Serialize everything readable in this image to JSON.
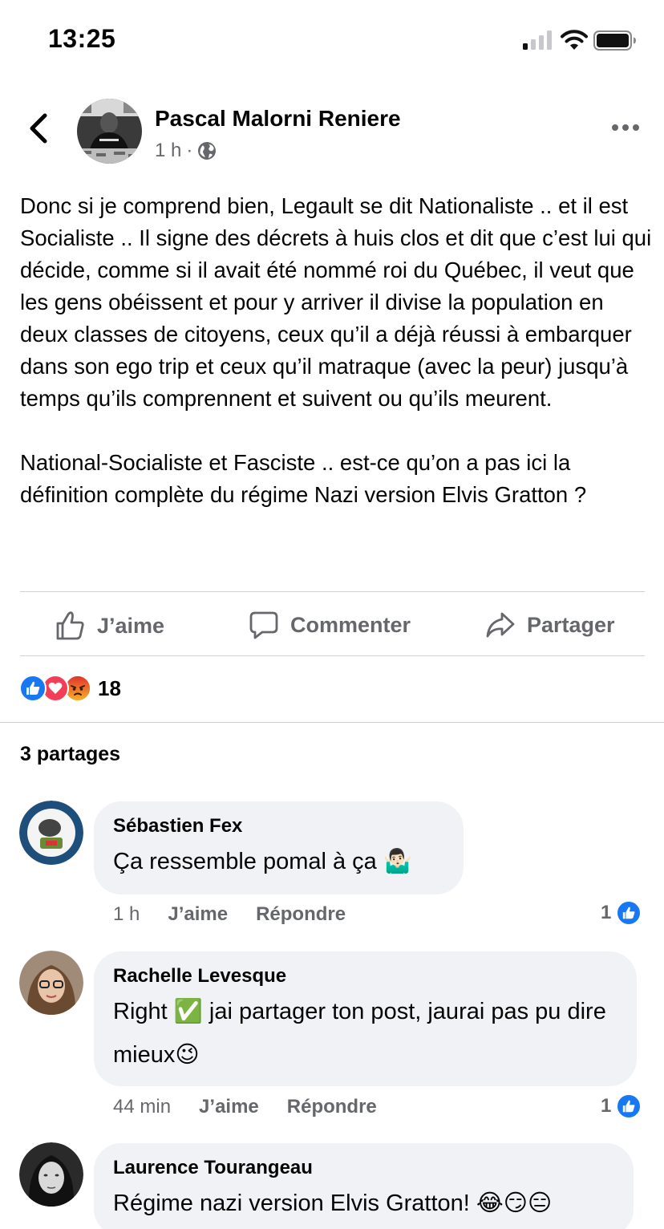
{
  "status_bar": {
    "time": "13:25"
  },
  "header": {
    "author": "Pascal Malorni Reniere",
    "time": "1 h",
    "separator": "·",
    "audience_icon": "globe-icon"
  },
  "post": {
    "text": "Donc si je comprend bien, Legault se dit Nationaliste .. et il est Socialiste .. Il signe des décrets à huis clos et dit que c’est lui qui décide, comme si il avait été nommé roi du Québec, il veut que les gens obéissent et pour y arriver il divise la population en deux classes de citoyens, ceux qu’il a déjà réussi à embarquer dans son ego trip et ceux qu’il matraque (avec la peur) jusqu’à temps qu’ils comprennent et suivent ou qu’ils meurent.\n\nNational-Socialiste et Fasciste .. est-ce qu’on a pas ici la définition complète du régime Nazi version Elvis Gratton ?"
  },
  "actions": {
    "like_label": "J’aime",
    "comment_label": "Commenter",
    "share_label": "Partager"
  },
  "reactions": {
    "icons": [
      "like-reaction-icon",
      "love-reaction-icon",
      "angry-reaction-icon"
    ],
    "count": "18"
  },
  "shares_label": "3 partages",
  "comments": [
    {
      "name": "Sébastien Fex",
      "text": "Ça ressemble pomal à ça 🤷🏻‍♂️",
      "time": "1 h",
      "like_label": "J’aime",
      "reply_label": "Répondre",
      "like_count": "1"
    },
    {
      "name": "Rachelle Levesque",
      "text": "Right ✅ jai partager ton post, jaurai pas pu dire mieux😉",
      "time": "44 min",
      "like_label": "J’aime",
      "reply_label": "Répondre",
      "like_count": "1"
    },
    {
      "name": "Laurence Tourangeau",
      "text": "Régime nazi version Elvis Gratton! 😂😏😑"
    }
  ],
  "colors": {
    "facebook_blue": "#1877f2",
    "secondary_text": "#65676b",
    "bubble_bg": "#f0f2f5",
    "love_red": "#f33e58",
    "angry_orange": "#e9710f"
  }
}
